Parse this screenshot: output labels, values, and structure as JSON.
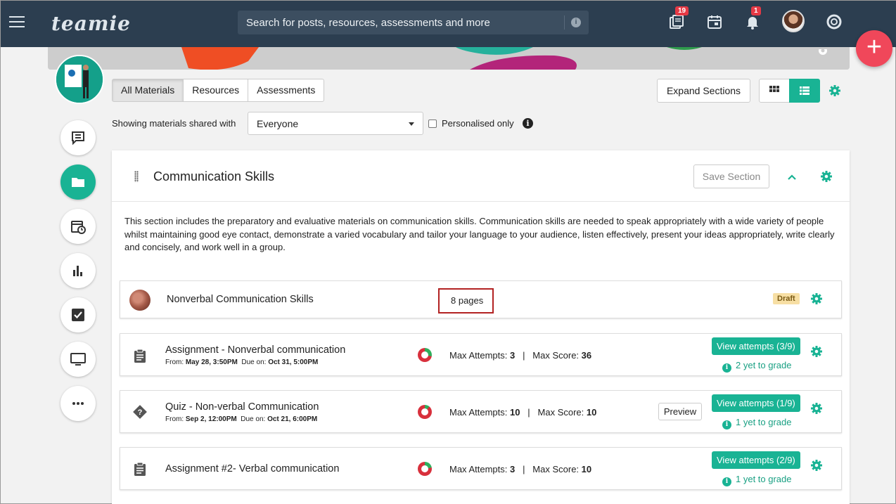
{
  "topbar": {
    "logo": "teamie",
    "search_placeholder": "Search for posts, resources, assessments and more",
    "badges": {
      "library": "19",
      "notifications": "1"
    }
  },
  "fab_label": "+",
  "tabs": [
    {
      "label": "All Materials",
      "active": true
    },
    {
      "label": "Resources",
      "active": false
    },
    {
      "label": "Assessments",
      "active": false
    }
  ],
  "toolbar": {
    "expand_label": "Expand Sections"
  },
  "filter": {
    "showing_label": "Showing materials shared with",
    "audience_value": "Everyone",
    "personalised_label": "Personalised only",
    "personalised_checked": false
  },
  "section": {
    "title": "Communication Skills",
    "save_label": "Save Section",
    "description": "This section includes the preparatory and evaluative materials on communication skills. Communication skills are needed to speak appropriately with a wide variety of people whilst maintaining good eye contact, demonstrate a varied vocabulary and tailor your language to your audience, listen effectively, present your ideas appropriately, write clearly and concisely, and work well in a group."
  },
  "materials": [
    {
      "title": "Nonverbal Communication Skills",
      "pages": "8 pages",
      "status": "Draft"
    },
    {
      "title": "Assignment - Nonverbal communication",
      "from_label": "From:",
      "from": "May 28, 3:50PM",
      "due_label": "Due on:",
      "due": "Oct 31, 5:00PM",
      "attempts_label": "Max Attempts:",
      "attempts": "3",
      "score_label": "Max Score:",
      "score": "36",
      "view": "View attempts (3/9)",
      "yet": "2 yet to grade"
    },
    {
      "title": "Quiz - Non-verbal Communication",
      "from_label": "From:",
      "from": "Sep 2, 12:00PM",
      "due_label": "Due on:",
      "due": "Oct 21, 6:00PM",
      "attempts_label": "Max Attempts:",
      "attempts": "10",
      "score_label": "Max Score:",
      "score": "10",
      "preview": "Preview",
      "view": "View attempts (1/9)",
      "yet": "1 yet to grade"
    },
    {
      "title": "Assignment #2- Verbal communication",
      "attempts_label": "Max Attempts:",
      "attempts": "3",
      "score_label": "Max Score:",
      "score": "10",
      "view": "View attempts (2/9)",
      "yet": "1 yet to grade"
    }
  ],
  "colors": {
    "accent": "#19b394",
    "topbar": "#2c3e50",
    "fab": "#f0475a",
    "highlight_box": "#b22222"
  }
}
